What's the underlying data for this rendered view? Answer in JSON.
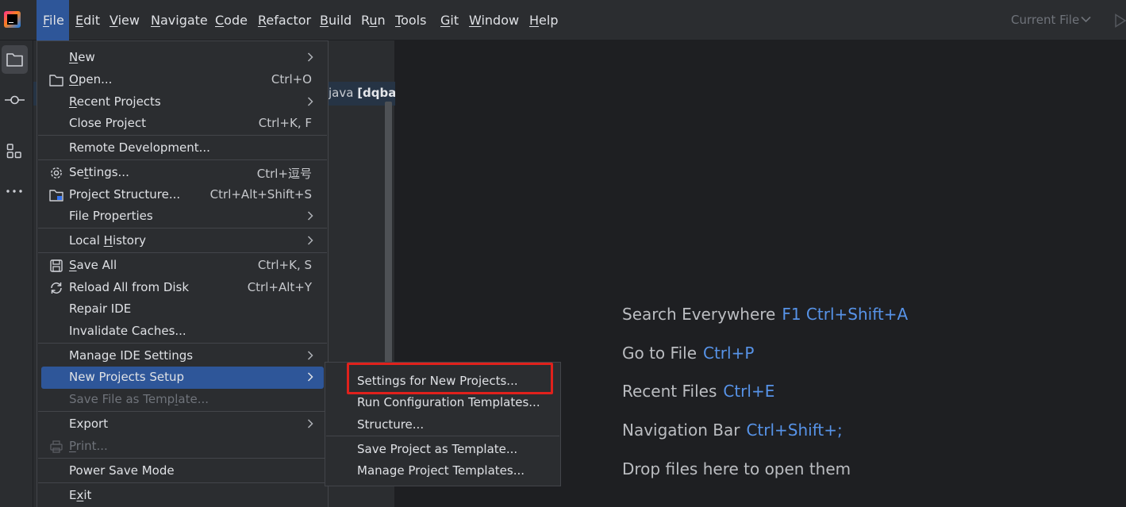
{
  "menubar": {
    "items": [
      {
        "pre": "",
        "m": "F",
        "post": "ile"
      },
      {
        "pre": "",
        "m": "E",
        "post": "dit"
      },
      {
        "pre": "",
        "m": "V",
        "post": "iew"
      },
      {
        "pre": "",
        "m": "N",
        "post": "avigate"
      },
      {
        "pre": "",
        "m": "C",
        "post": "ode"
      },
      {
        "pre": "",
        "m": "R",
        "post": "efactor"
      },
      {
        "pre": "",
        "m": "B",
        "post": "uild"
      },
      {
        "pre": "R",
        "m": "u",
        "post": "n"
      },
      {
        "pre": "",
        "m": "T",
        "post": "ools"
      },
      {
        "pre": "",
        "m": "G",
        "post": "it"
      },
      {
        "pre": "",
        "m": "W",
        "post": "indow"
      },
      {
        "pre": "",
        "m": "H",
        "post": "elp"
      }
    ],
    "run_config": "Current File"
  },
  "project_panel": {
    "tree_row_prefix": "java ",
    "tree_row_bold": "[dqbas"
  },
  "file_menu": {
    "items": [
      {
        "pre": "",
        "m": "N",
        "post": "ew",
        "shortcut": ""
      },
      {
        "pre": "",
        "m": "O",
        "post": "pen...",
        "shortcut": "Ctrl+O"
      },
      {
        "pre": "",
        "m": "R",
        "post": "ecent Projects",
        "shortcut": ""
      },
      {
        "pre": "Close Project",
        "m": "",
        "post": "",
        "shortcut": "Ctrl+K, F"
      },
      {
        "pre": "Remote Development...",
        "m": "",
        "post": "",
        "shortcut": ""
      },
      {
        "pre": "Se",
        "m": "t",
        "post": "tings...",
        "shortcut": "Ctrl+逗号"
      },
      {
        "pre": "Project Structure...",
        "m": "",
        "post": "",
        "shortcut": "Ctrl+Alt+Shift+S"
      },
      {
        "pre": "File Properties",
        "m": "",
        "post": "",
        "shortcut": ""
      },
      {
        "pre": "Local ",
        "m": "H",
        "post": "istory",
        "shortcut": ""
      },
      {
        "pre": "",
        "m": "S",
        "post": "ave All",
        "shortcut": "Ctrl+K, S"
      },
      {
        "pre": "Reload All from Disk",
        "m": "",
        "post": "",
        "shortcut": "Ctrl+Alt+Y"
      },
      {
        "pre": "Repair IDE",
        "m": "",
        "post": "",
        "shortcut": ""
      },
      {
        "pre": "Invalidate Caches...",
        "m": "",
        "post": "",
        "shortcut": ""
      },
      {
        "pre": "Manage IDE Settings",
        "m": "",
        "post": "",
        "shortcut": ""
      },
      {
        "pre": "New Projects Setup",
        "m": "",
        "post": "",
        "shortcut": ""
      },
      {
        "pre": "Save File as Temp",
        "m": "l",
        "post": "ate...",
        "shortcut": ""
      },
      {
        "pre": "Export",
        "m": "",
        "post": "",
        "shortcut": ""
      },
      {
        "pre": "",
        "m": "P",
        "post": "rint...",
        "shortcut": ""
      },
      {
        "pre": "Power Save Mode",
        "m": "",
        "post": "",
        "shortcut": ""
      },
      {
        "pre": "E",
        "m": "x",
        "post": "it",
        "shortcut": ""
      }
    ]
  },
  "sub_menu": {
    "items": [
      "Settings for New Projects...",
      "Run Configuration Templates...",
      "Structure...",
      "Save Project as Template...",
      "Manage Project Templates..."
    ]
  },
  "welcome": {
    "hints": [
      {
        "label": "Search Everywhere",
        "keys": "F1 Ctrl+Shift+A"
      },
      {
        "label": "Go to File",
        "keys": "Ctrl+P"
      },
      {
        "label": "Recent Files",
        "keys": "Ctrl+E"
      },
      {
        "label": "Navigation Bar",
        "keys": "Ctrl+Shift+;"
      },
      {
        "label": "Drop files here to open them",
        "keys": ""
      }
    ]
  },
  "colors": {
    "accent": "#2e5699",
    "shortcut_blue": "#5793e8",
    "highlight_box": "#e0211c",
    "editor_bg": "#1e1f22",
    "panel_bg": "#2b2d30"
  }
}
